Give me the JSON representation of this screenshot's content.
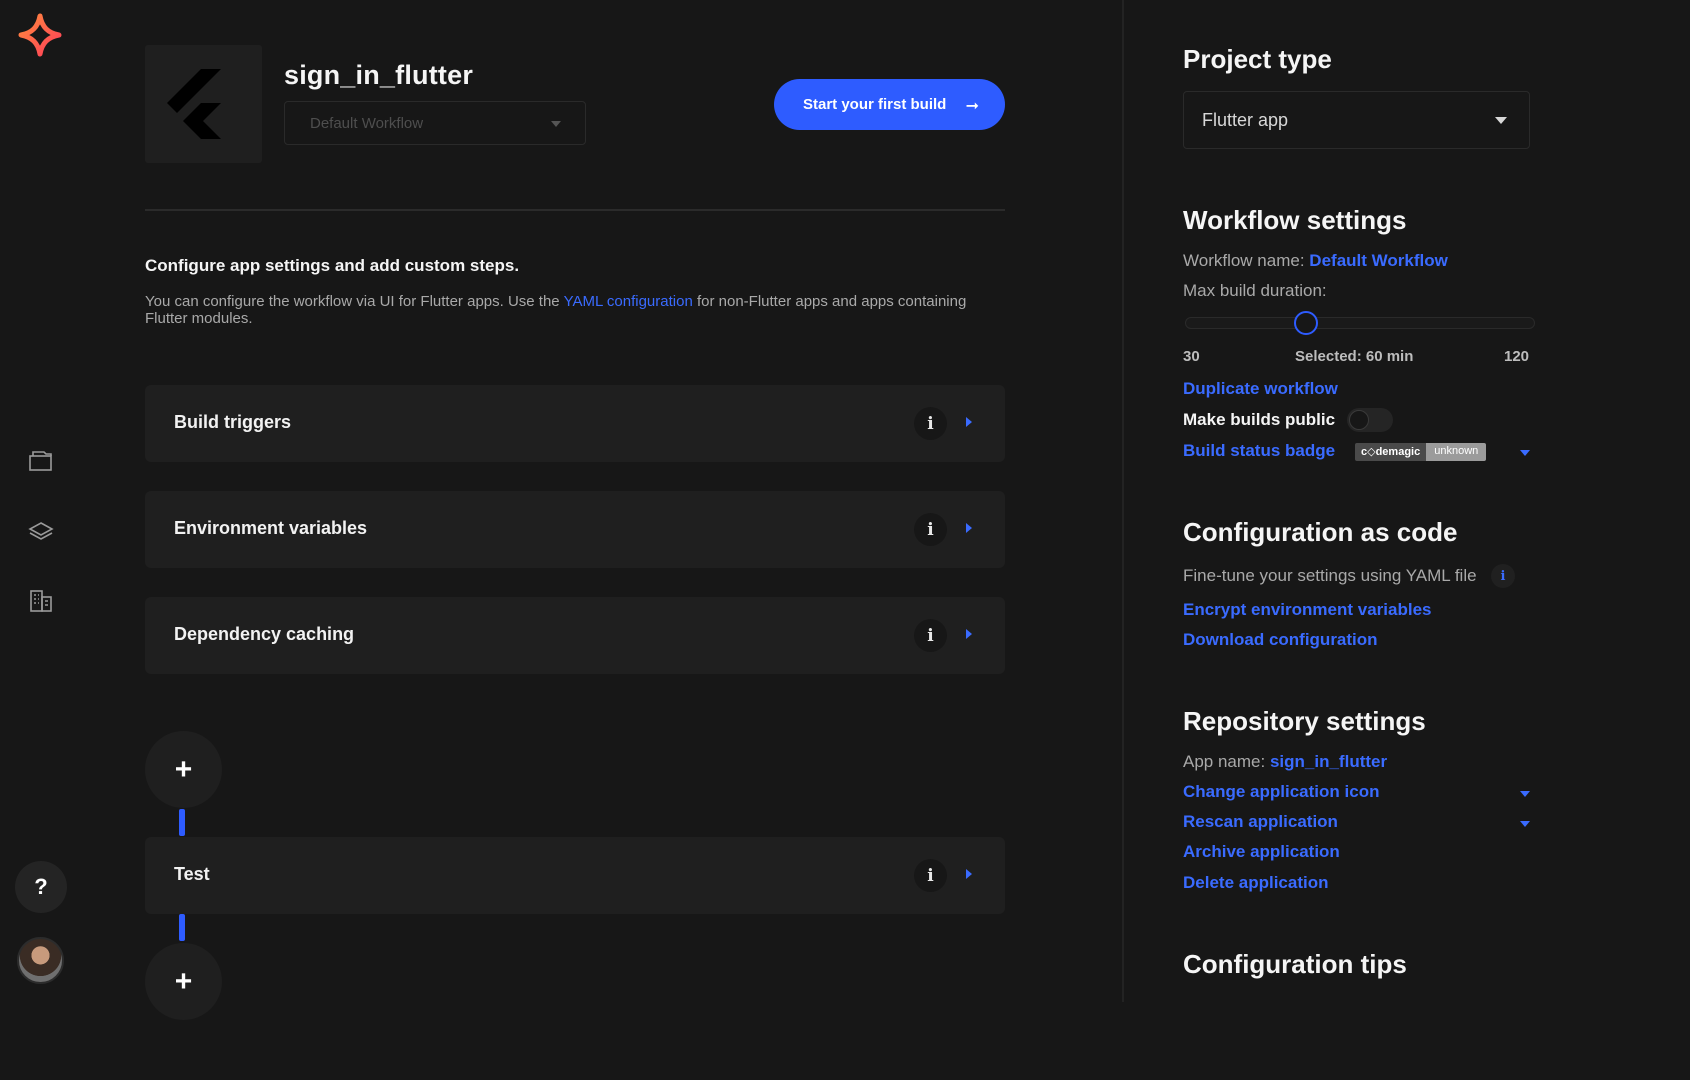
{
  "app": {
    "title": "sign_in_flutter",
    "workflow_select": "Default Workflow",
    "start_button": "Start your first build"
  },
  "config": {
    "heading": "Configure app settings and add custom steps.",
    "desc_before": "You can configure the workflow via UI for Flutter apps. Use the ",
    "desc_link": "YAML configuration",
    "desc_after": " for non-Flutter apps and apps containing Flutter modules."
  },
  "steps": {
    "build_triggers": "Build triggers",
    "env_vars": "Environment variables",
    "dep_caching": "Dependency caching",
    "test": "Test"
  },
  "icons": {
    "info_glyph": "i",
    "plus_glyph": "+",
    "help_glyph": "?",
    "arrow_glyph": "➞"
  },
  "project_type": {
    "heading": "Project type",
    "value": "Flutter app"
  },
  "workflow_settings": {
    "heading": "Workflow settings",
    "name_label": "Workflow name:",
    "name_value": "Default Workflow",
    "duration_label": "Max build duration:",
    "min": "30",
    "selected": "Selected: 60 min",
    "max": "120",
    "selected_value": 60,
    "duplicate": "Duplicate workflow",
    "public_label": "Make builds public",
    "public_enabled": false,
    "badge_link": "Build status badge",
    "badge_left": "c◇demagic",
    "badge_right": "unknown"
  },
  "config_as_code": {
    "heading": "Configuration as code",
    "desc": "Fine-tune your settings using YAML file",
    "encrypt": "Encrypt environment variables",
    "download": "Download configuration"
  },
  "repo_settings": {
    "heading": "Repository settings",
    "app_name_label": "App name:",
    "app_name_value": "sign_in_flutter",
    "change_icon": "Change application icon",
    "rescan": "Rescan application",
    "archive": "Archive application",
    "delete": "Delete application"
  },
  "tips": {
    "heading": "Configuration tips"
  },
  "colors": {
    "accent": "#2e5cff",
    "link": "#3a6bff",
    "background": "#171717",
    "card": "#1f1f1f"
  }
}
